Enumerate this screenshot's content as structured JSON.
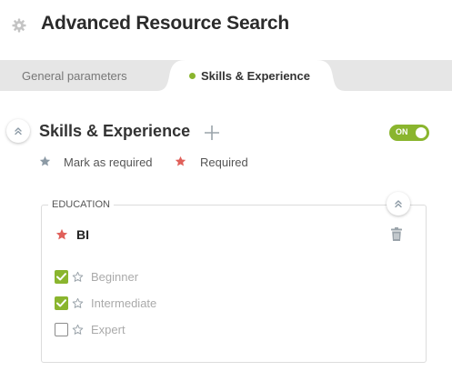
{
  "header": {
    "title": "Advanced Resource Search",
    "icon": "gear-icon"
  },
  "tabs": [
    {
      "label": "General parameters",
      "active": false
    },
    {
      "label": "Skills & Experience",
      "active": true,
      "indicator_color": "#8ab52e"
    }
  ],
  "section": {
    "title": "Skills & Experience",
    "toggle_label": "ON",
    "toggle_on": true
  },
  "legend": {
    "mark_required": "Mark as required",
    "required": "Required"
  },
  "education": {
    "label": "EDUCATION",
    "skill": {
      "name": "BI",
      "required": true
    },
    "levels": [
      {
        "label": "Beginner",
        "checked": true
      },
      {
        "label": "Intermediate",
        "checked": true
      },
      {
        "label": "Expert",
        "checked": false
      }
    ]
  },
  "colors": {
    "accent": "#8ab52e",
    "required_star": "#e0605a",
    "optional_star": "#8c9aa5",
    "tab_bar": "#e6e6e6"
  }
}
